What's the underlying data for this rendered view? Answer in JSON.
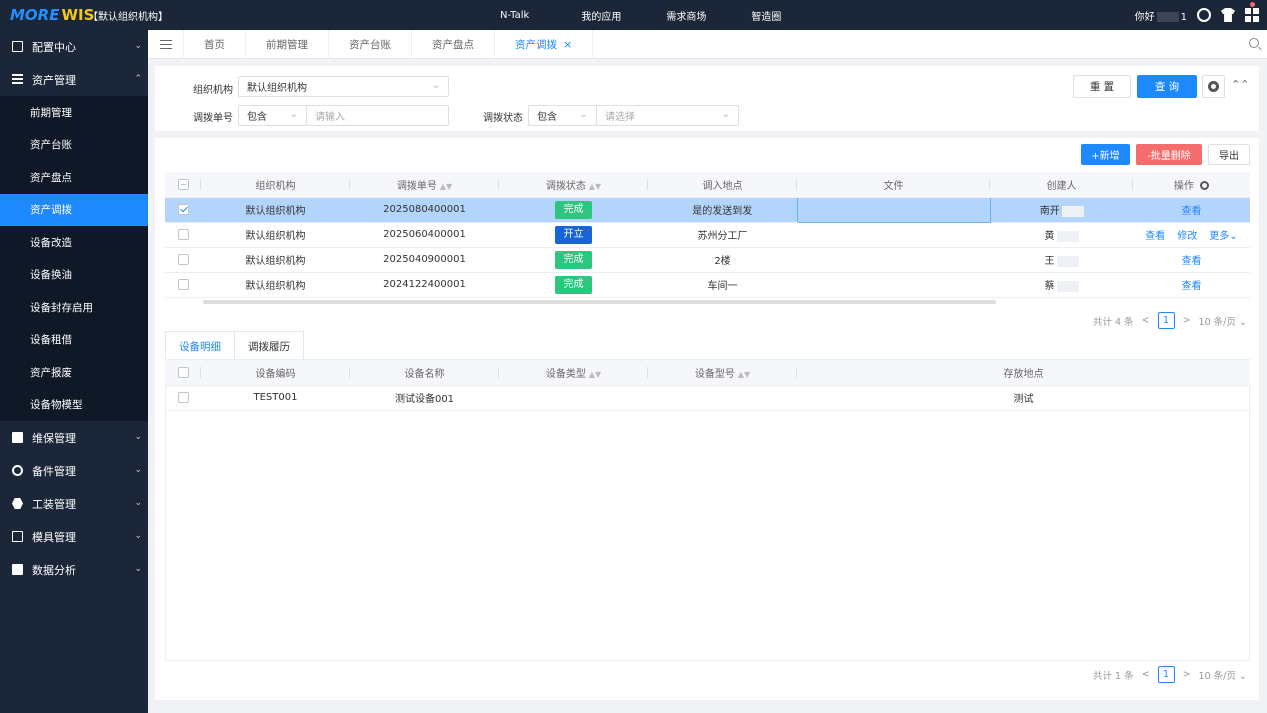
{
  "header": {
    "logo_part1": "MORE",
    "logo_part2": "WIS",
    "org": "【默认组织机构】",
    "nav": [
      "N-Talk",
      "我的应用",
      "需求商场",
      "智造圈"
    ],
    "user_prefix": "你好",
    "user_suffix": "1"
  },
  "sidebar": {
    "groups": [
      {
        "label": "配置中心",
        "icon": "id-card-icon"
      },
      {
        "label": "资产管理",
        "icon": "list-icon"
      }
    ],
    "asset_items": [
      "前期管理",
      "资产台账",
      "资产盘点",
      "资产调拨",
      "设备改造",
      "设备换油",
      "设备封存启用",
      "设备租借",
      "资产报废",
      "设备物模型"
    ],
    "active_item": "资产调拨",
    "groups_after": [
      {
        "label": "维保管理",
        "icon": "toolbox-icon"
      },
      {
        "label": "备件管理",
        "icon": "gear-icon"
      },
      {
        "label": "工装管理",
        "icon": "hexagon-icon"
      },
      {
        "label": "模具管理",
        "icon": "mold-icon"
      },
      {
        "label": "数据分析",
        "icon": "bar-chart-icon"
      }
    ]
  },
  "tabs": [
    "首页",
    "前期管理",
    "资产台账",
    "资产盘点",
    "资产调拨"
  ],
  "active_tab": "资产调拨",
  "filter": {
    "org_label": "组织机构",
    "org_value": "默认组织机构",
    "no_label": "调拨单号",
    "no_op": "包含",
    "no_placeholder": "请输入",
    "status_label": "调拨状态",
    "status_op": "包含",
    "status_placeholder": "请选择",
    "reset_label": "重 置",
    "query_label": "查 询"
  },
  "toolbar": {
    "add_label": "+新增",
    "batch_delete_label": "-批量删除",
    "export_label": "导出"
  },
  "table": {
    "columns": [
      "组织机构",
      "调拨单号",
      "调拨状态",
      "调入地点",
      "文件",
      "创建人",
      "操作"
    ],
    "rows": [
      {
        "org": "默认组织机构",
        "no": "2025080400001",
        "status": "完成",
        "status_type": "done",
        "location": "是的发送到发",
        "file": "",
        "creator": "南开",
        "actions": [
          "查看"
        ],
        "selected": true
      },
      {
        "org": "默认组织机构",
        "no": "2025060400001",
        "status": "开立",
        "status_type": "open",
        "location": "苏州分工厂",
        "file": "",
        "creator": "黄",
        "actions": [
          "查看",
          "修改",
          "更多"
        ],
        "selected": false
      },
      {
        "org": "默认组织机构",
        "no": "2025040900001",
        "status": "完成",
        "status_type": "done",
        "location": "2楼",
        "file": "",
        "creator": "王",
        "actions": [
          "查看"
        ],
        "selected": false
      },
      {
        "org": "默认组织机构",
        "no": "2024122400001",
        "status": "完成",
        "status_type": "done",
        "location": "车间一",
        "file": "",
        "creator": "蔡",
        "actions": [
          "查看"
        ],
        "selected": false
      }
    ],
    "pager_total": "共计 4 条",
    "pager_page": "1",
    "pager_size": "10 条/页"
  },
  "detail": {
    "tabs": [
      "设备明细",
      "调拨履历"
    ],
    "columns": [
      "设备编码",
      "设备名称",
      "设备类型",
      "设备型号",
      "存放地点"
    ],
    "rows": [
      {
        "code": "TEST001",
        "name": "测试设备001",
        "type": "",
        "model": "",
        "location": "测试"
      }
    ],
    "pager_total": "共计 1 条",
    "pager_page": "1",
    "pager_size": "10 条/页"
  }
}
